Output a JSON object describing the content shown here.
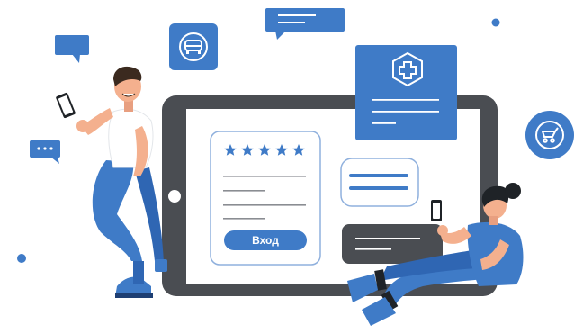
{
  "login_card": {
    "rating_stars": 5,
    "login_label": "Вход"
  },
  "colors": {
    "primary": "#3f7bc7",
    "tablet_frame": "#4a4d52",
    "screen": "#ffffff",
    "card_border": "#8fb0dd",
    "dark_note": "#4a4d52",
    "skin": "#f4b08e",
    "hair": "#3b2a1f"
  },
  "icons": [
    "car-icon",
    "medical-cross-icon",
    "baby-stroller-icon",
    "speech-bubble-icon",
    "smartphone-icon"
  ]
}
